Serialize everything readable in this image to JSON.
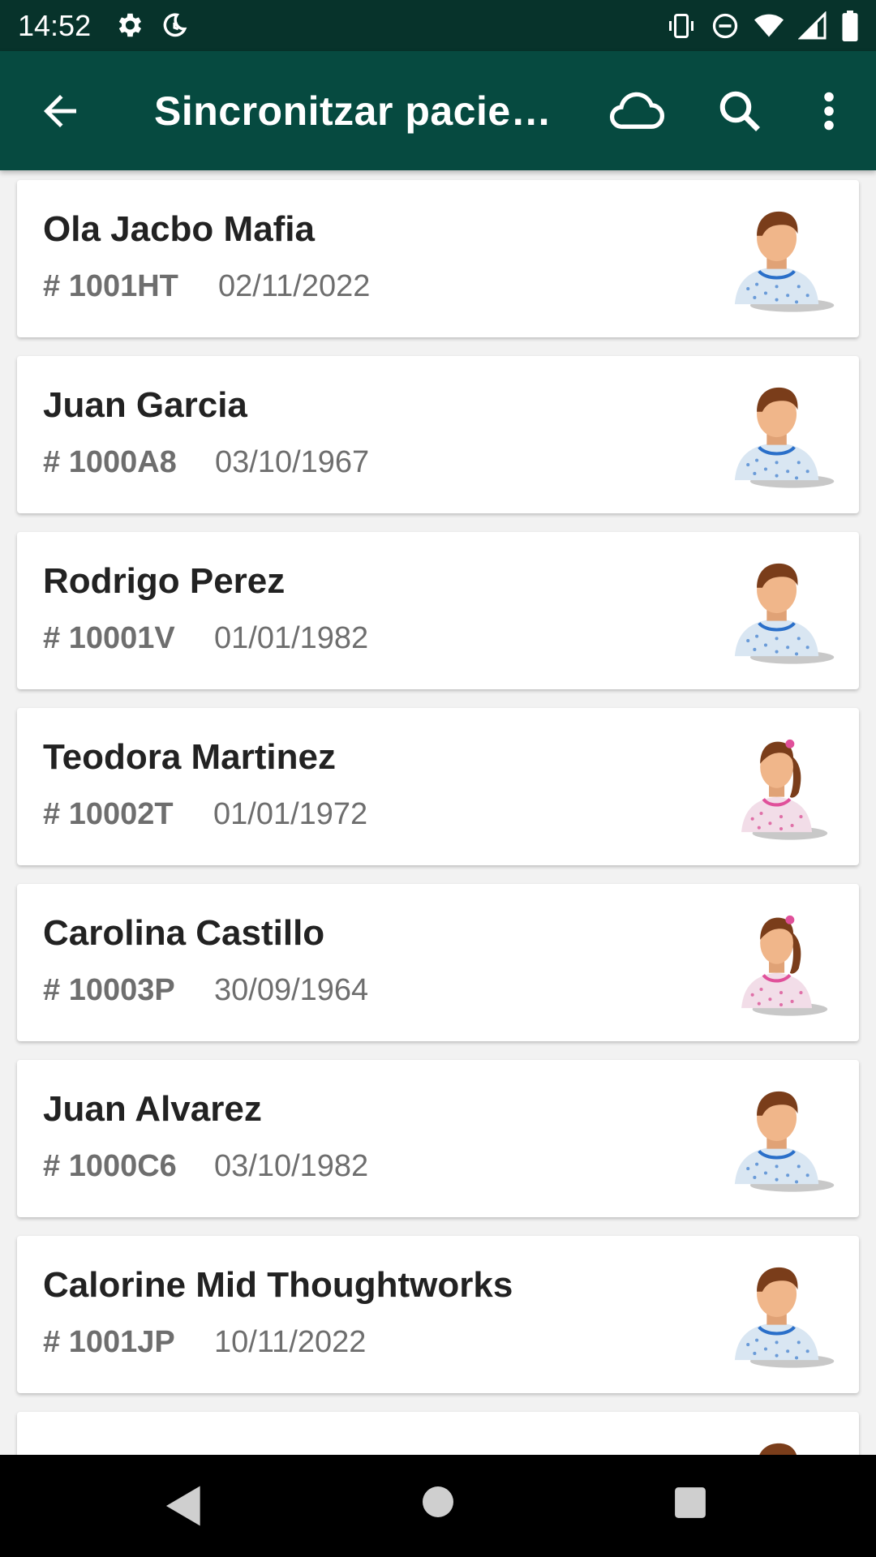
{
  "status": {
    "time": "14:52",
    "left_icons": [
      "gear-icon",
      "moon-clock-icon"
    ],
    "right_icons": [
      "vibrate-icon",
      "do-not-disturb-icon",
      "wifi-icon",
      "signal-icon",
      "battery-icon"
    ]
  },
  "appbar": {
    "title": "Sincronitzar pacien…",
    "actions": [
      "back-arrow-icon",
      "cloud-icon",
      "search-icon",
      "more-vertical-icon"
    ]
  },
  "colors": {
    "status_bar": "#07332b",
    "app_bar": "#064a40",
    "card_bg": "#ffffff",
    "name_text": "#222222",
    "meta_text": "#6e6e6e"
  },
  "patients": [
    {
      "name": "Ola Jacbo Mafia",
      "code": "# 1001HT",
      "date": "02/11/2022",
      "avatar": "male-patient-icon"
    },
    {
      "name": "Juan Garcia",
      "code": "# 1000A8",
      "date": "03/10/1967",
      "avatar": "male-patient-icon"
    },
    {
      "name": "Rodrigo Perez",
      "code": "# 10001V",
      "date": "01/01/1982",
      "avatar": "male-patient-icon"
    },
    {
      "name": "Teodora Martinez",
      "code": "# 10002T",
      "date": "01/01/1972",
      "avatar": "female-patient-icon"
    },
    {
      "name": "Carolina Castillo",
      "code": "# 10003P",
      "date": "30/09/1964",
      "avatar": "female-patient-icon"
    },
    {
      "name": "Juan Alvarez",
      "code": "# 1000C6",
      "date": "03/10/1982",
      "avatar": "male-patient-icon"
    },
    {
      "name": "Calorine Mid Thoughtworks",
      "code": "# 1001JP",
      "date": "10/11/2022",
      "avatar": "male-patient-icon"
    },
    {
      "name": "",
      "code": "",
      "date": "",
      "avatar": "male-patient-icon"
    }
  ],
  "navbar": [
    "nav-back-icon",
    "nav-home-icon",
    "nav-recents-icon"
  ]
}
